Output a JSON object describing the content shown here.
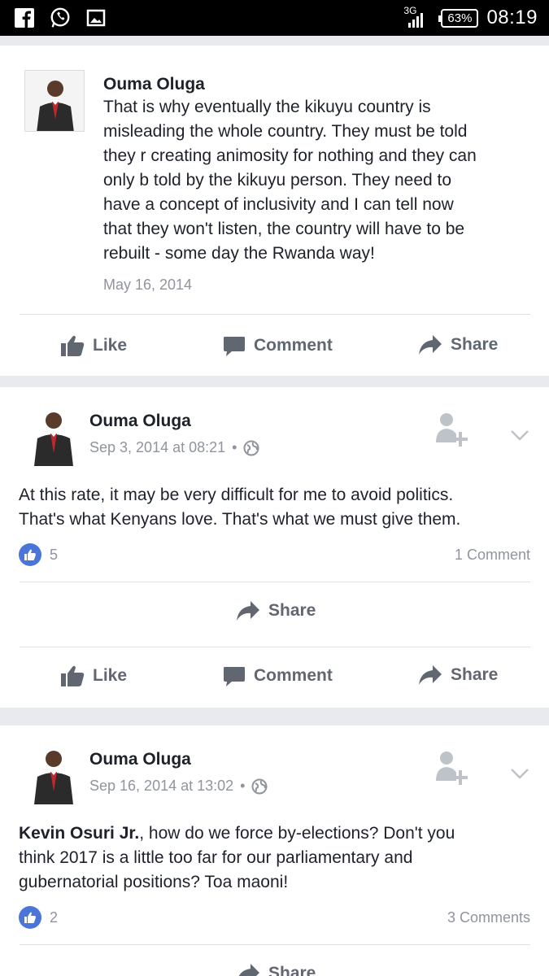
{
  "status_bar": {
    "network": "3G",
    "battery": "63%",
    "time": "08:19",
    "icons": [
      "facebook-icon",
      "whatsapp-icon",
      "gallery-icon"
    ]
  },
  "posts": [
    {
      "author": "Ouma Oluga",
      "text": "That is why eventually the kikuyu country is misleading the whole country. They must be told they r creating animosity for nothing and they can only b told by the kikuyu person. They need to have a concept of inclusivity and I can tell now that they won't listen, the country will have to be rebuilt - some day the Rwanda way!",
      "lines": [
        "That is why eventually the kikuyu country is",
        "misleading the whole country. They must be told",
        "they r creating animosity for nothing and they can",
        "only b told by the kikuyu person. They need to",
        "have a concept of inclusivity and I can tell now",
        "that they won't listen, the country will have to be",
        "rebuilt - some day the Rwanda way!"
      ],
      "date": "May 16, 2014",
      "actions": {
        "like": "Like",
        "comment": "Comment",
        "share": "Share"
      }
    },
    {
      "author": "Ouma Oluga",
      "date": "Sep 3, 2014 at 08:21",
      "privacy_separator": "•",
      "lines": [
        "At this rate, it may be very difficult for me to avoid politics.",
        "That's what Kenyans love. That's what we must give them."
      ],
      "likes": "5",
      "comments": "1 Comment",
      "share_row": "Share",
      "actions": {
        "like": "Like",
        "comment": "Comment",
        "share": "Share"
      }
    },
    {
      "author": "Ouma Oluga",
      "date": "Sep 16, 2014 at 13:02",
      "privacy_separator": "•",
      "mention": "Kevin Osuri Jr.",
      "lines": [
        ", how do we force by-elections? Don't you",
        "think 2017 is a little too far for our parliamentary and",
        "gubernatorial positions? Toa maoni!"
      ],
      "likes": "2",
      "comments": "3 Comments",
      "share_row": "Share"
    }
  ],
  "colors": {
    "facebook_blue": "#4a76d9",
    "meta_gray": "#90949c",
    "action_gray": "#606770",
    "divider": "#dddfe2",
    "feed_bg": "#e9eaed"
  }
}
